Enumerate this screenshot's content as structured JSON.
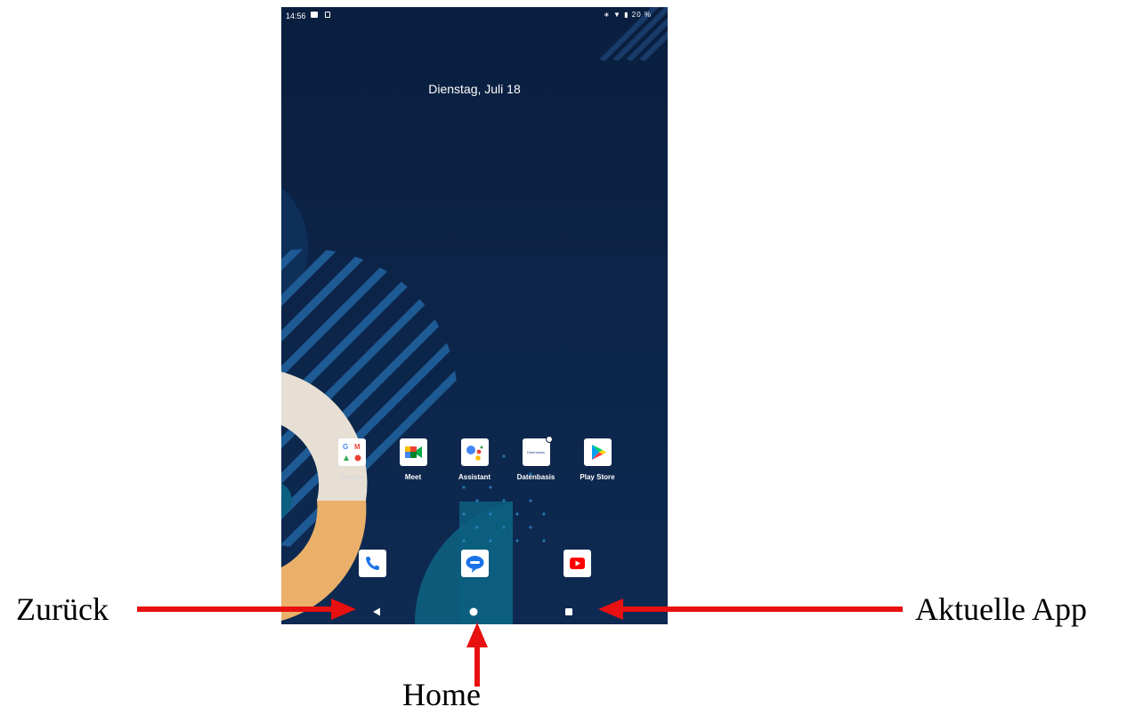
{
  "status_bar": {
    "time": "14:56",
    "battery": "20 %"
  },
  "home": {
    "date": "Dienstag, Juli 18"
  },
  "apps": [
    {
      "label": "Google",
      "icon": "google-folder-icon"
    },
    {
      "label": "Meet",
      "icon": "meet-icon"
    },
    {
      "label": "Assistant",
      "icon": "assistant-icon"
    },
    {
      "label": "Datenbasis",
      "icon": "datenbasis-icon",
      "tile_text": "Datenbasis"
    },
    {
      "label": "Play Store",
      "icon": "play-store-icon"
    }
  ],
  "dock": [
    {
      "icon": "phone-icon"
    },
    {
      "icon": "messages-icon"
    },
    {
      "icon": "youtube-icon"
    }
  ],
  "annotations": {
    "back": "Zurück",
    "home": "Home",
    "recents": "Aktuelle App"
  },
  "colors": {
    "annotation_arrow": "#e81010",
    "wallpaper_bg": "#0c2448",
    "accent_beige": "#e7dfd4",
    "accent_orange": "#eab06a",
    "accent_teal": "#0d5f80"
  }
}
